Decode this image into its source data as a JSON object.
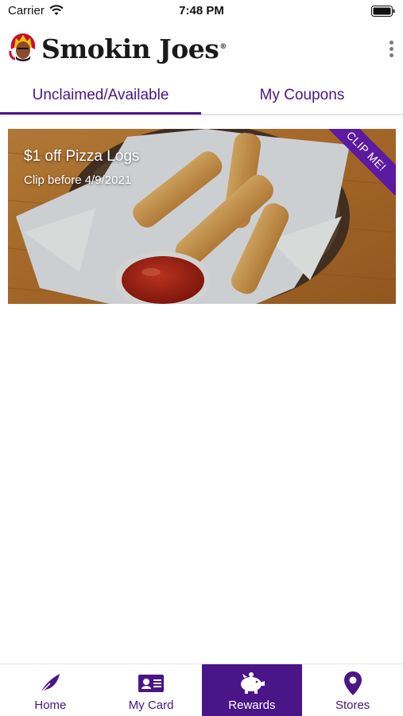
{
  "status_bar": {
    "carrier": "Carrier",
    "time": "7:48 PM"
  },
  "header": {
    "brand_name": "Smokin Joes",
    "brand_mark": "®"
  },
  "tabs": [
    {
      "label": "Unclaimed/Available",
      "active": true
    },
    {
      "label": "My Coupons",
      "active": false
    }
  ],
  "coupon": {
    "title": "$1 off Pizza Logs",
    "subtitle": "Clip before 4/9/2021",
    "ribbon": "CLIP ME!"
  },
  "bottom_nav": [
    {
      "label": "Home",
      "icon": "feather-icon",
      "active": false
    },
    {
      "label": "My Card",
      "icon": "id-card-icon",
      "active": false
    },
    {
      "label": "Rewards",
      "icon": "piggy-bank-icon",
      "active": true
    },
    {
      "label": "Stores",
      "icon": "map-pin-icon",
      "active": false
    }
  ],
  "colors": {
    "brand_purple": "#4a1587",
    "ribbon_purple": "#5b1aa0"
  }
}
